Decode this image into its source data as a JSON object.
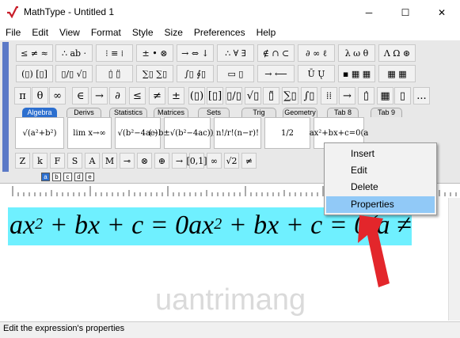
{
  "window": {
    "title": "MathType - Untitled 1",
    "minimize_glyph": "─",
    "maximize_glyph": "☐",
    "close_glyph": "✕"
  },
  "menu": [
    "File",
    "Edit",
    "View",
    "Format",
    "Style",
    "Size",
    "Preferences",
    "Help"
  ],
  "palette_row1": [
    "≤ ≠ ≈",
    "∴ ab ·",
    "⁝ ≡ ⁞",
    "± • ⊗",
    "→ ⇔ ↓",
    "∴ ∀ ∃",
    "∉ ∩ ⊂",
    "∂ ∞ ℓ",
    "λ ω θ",
    "Λ Ω ⊛"
  ],
  "palette_row2": [
    "(▯) [▯]",
    "▯/▯ √▯",
    "▯̇ ▯̈",
    "∑▯ ∑▯",
    "∫▯ ∮▯",
    "▭ ▯",
    "→ ⟵",
    "Ū Ų",
    "▪ ▦ ▦",
    "▦ ▦"
  ],
  "palette_row3": [
    "π",
    "θ",
    "∞",
    "∈",
    "→",
    "∂",
    "≤",
    "≠",
    "±",
    "(▯)",
    "[▯]",
    "▯/▯",
    "√▯",
    "▯̃",
    "∑▯",
    "∫▯",
    "⁞⁞",
    "→",
    "▯̇",
    "▦",
    "▯",
    "..."
  ],
  "tabs": [
    "Algebra",
    "Derivs",
    "Statistics",
    "Matrices",
    "Sets",
    "Trig",
    "Geometry",
    "Tab 8",
    "Tab 9"
  ],
  "templates": [
    "√(a²+b²)",
    "lim x→∞",
    "√(b²−4ac)",
    "(−b±√(b²−4ac))/2a",
    "n!/r!(n−r)!",
    "1/2",
    "ax²+bx+c=0(a"
  ],
  "row5": [
    "Z",
    "k",
    "F",
    "S",
    "A",
    "M",
    "⊸",
    "⊗",
    "⊕",
    "→",
    "[0,1]",
    "∞",
    "√2",
    "≠"
  ],
  "size_buttons": [
    "a",
    "b",
    "c",
    "d",
    "e"
  ],
  "equation": {
    "parts": [
      "ax",
      "2",
      " + bx + c = 0ax",
      "2",
      " + bx + c = 0(a ≠"
    ]
  },
  "context_menu": {
    "items": [
      "Insert",
      "Edit",
      "Delete",
      "Properties"
    ],
    "highlighted": "Properties"
  },
  "watermark": "uantrimang",
  "status": "Edit the expression's properties",
  "colors": {
    "selection": "#6ff0ff",
    "menu_highlight": "#91c9f7",
    "arrow": "#e3262b",
    "active_tab": "#2c6fcf"
  }
}
